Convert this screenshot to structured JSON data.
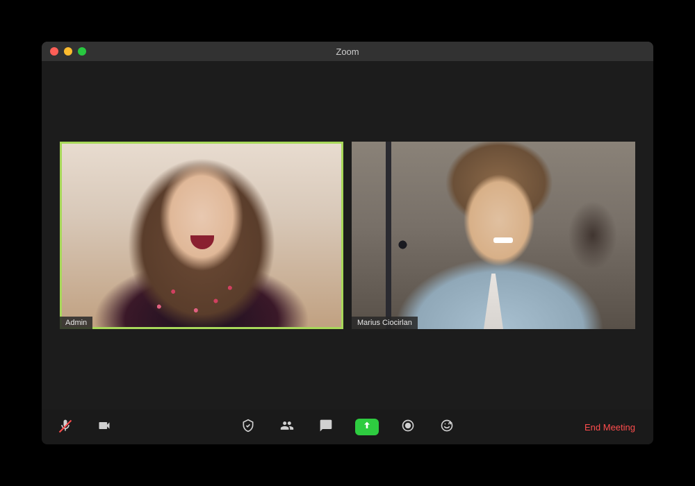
{
  "window": {
    "title": "Zoom"
  },
  "participants": [
    {
      "name": "Admin",
      "active": true
    },
    {
      "name": "Marius Ciocirlan",
      "active": false
    }
  ],
  "toolbar": {
    "audio_icon": "microphone-muted-icon",
    "video_icon": "camera-icon",
    "security_icon": "shield-icon",
    "participants_icon": "participants-icon",
    "chat_icon": "chat-icon",
    "share_icon": "share-screen-icon",
    "record_icon": "record-icon",
    "reactions_icon": "reactions-icon",
    "end_label": "End Meeting"
  },
  "colors": {
    "active_border": "#a8d85a",
    "share_green": "#2ecc40",
    "end_red": "#ff4d4d"
  }
}
